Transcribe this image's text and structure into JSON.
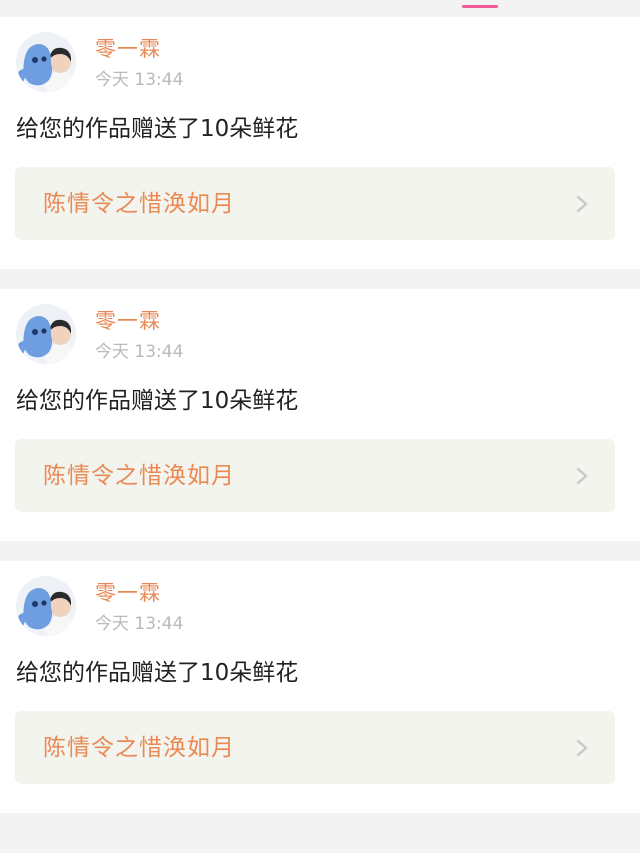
{
  "colors": {
    "accent": "#e98a55",
    "tab_indicator": "#ee5a9a",
    "timestamp": "#b9b9b9",
    "link_background": "#f4f4ef",
    "chevron": "#c8c8c8"
  },
  "notifications": [
    {
      "avatar_icon": "user-avatar",
      "username": "零一霖",
      "time": "今天 13:44",
      "message": "给您的作品赠送了10朵鲜花",
      "work_title": "陈情令之惜涣如月",
      "chevron_icon": "chevron-right-icon"
    },
    {
      "avatar_icon": "user-avatar",
      "username": "零一霖",
      "time": "今天 13:44",
      "message": "给您的作品赠送了10朵鲜花",
      "work_title": "陈情令之惜涣如月",
      "chevron_icon": "chevron-right-icon"
    },
    {
      "avatar_icon": "user-avatar",
      "username": "零一霖",
      "time": "今天 13:44",
      "message": "给您的作品赠送了10朵鲜花",
      "work_title": "陈情令之惜涣如月",
      "chevron_icon": "chevron-right-icon"
    }
  ]
}
